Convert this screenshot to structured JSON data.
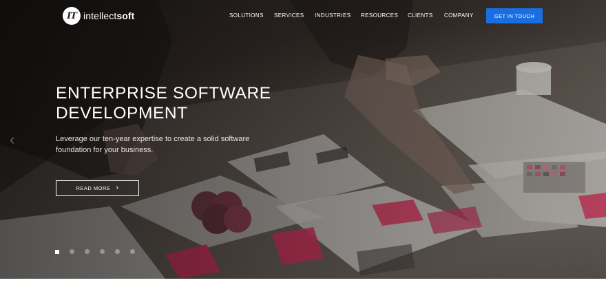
{
  "header": {
    "logo": {
      "mark": "IT",
      "text_regular": "intellect",
      "text_bold": "soft"
    },
    "nav": [
      {
        "label": "SOLUTIONS"
      },
      {
        "label": "SERVICES"
      },
      {
        "label": "INDUSTRIES"
      },
      {
        "label": "RESOURCES"
      },
      {
        "label": "CLIENTS"
      },
      {
        "label": "COMPANY"
      }
    ],
    "cta_label": "GET IN TOUCH"
  },
  "hero": {
    "headline_line1": "ENTERPRISE SOFTWARE",
    "headline_line2": "DEVELOPMENT",
    "subtext_line1": "Leverage our ten-year expertise to create a solid software",
    "subtext_line2": "foundation for your business.",
    "button_label": "READ MORE",
    "button_arrow": "›",
    "prev_arrow": "‹",
    "slider": {
      "total": 6,
      "active_index": 0
    }
  },
  "colors": {
    "accent": "#1a6fe0",
    "text_light": "#ffffff",
    "paper_pink": "#d6365e"
  },
  "icons": [
    "logo-icon",
    "chevron-right-icon",
    "chevron-left-icon"
  ]
}
